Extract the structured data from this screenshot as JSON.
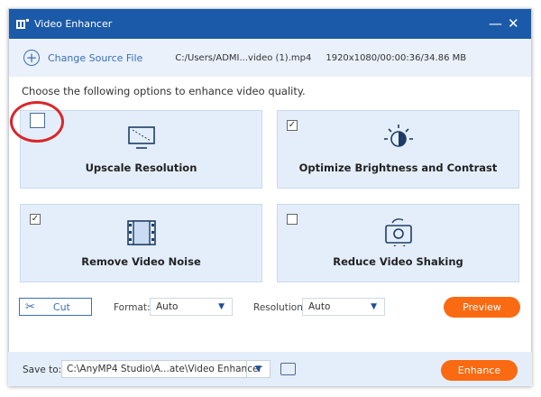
{
  "window": {
    "title": "Video Enhancer",
    "minimize": "—",
    "close": "✕"
  },
  "source": {
    "change_label": "Change Source File",
    "path": "C:/Users/ADMI...video (1).mp4",
    "meta": "1920x1080/00:00:36/34.86 MB"
  },
  "hint": "Choose the following options to enhance video quality.",
  "options": [
    {
      "label": "Upscale Resolution",
      "checked": false,
      "icon": "monitor-upscale-icon"
    },
    {
      "label": "Optimize Brightness and Contrast",
      "checked": true,
      "icon": "brightness-icon"
    },
    {
      "label": "Remove Video Noise",
      "checked": true,
      "icon": "film-noise-icon"
    },
    {
      "label": "Reduce Video Shaking",
      "checked": false,
      "icon": "camera-stabilize-icon"
    }
  ],
  "toolbar": {
    "cut_label": "Cut",
    "format_label": "Format:",
    "format_value": "Auto",
    "resolution_label": "Resolution:",
    "resolution_value": "Auto",
    "preview_label": "Preview"
  },
  "footer": {
    "save_label": "Save to:",
    "save_path": "C:\\AnyMP4 Studio\\A...ate\\Video Enhancer",
    "enhance_label": "Enhance"
  },
  "colors": {
    "accent": "#fa6a12",
    "title_bar": "#1b5aa8",
    "highlight_ring": "#d9262a"
  }
}
